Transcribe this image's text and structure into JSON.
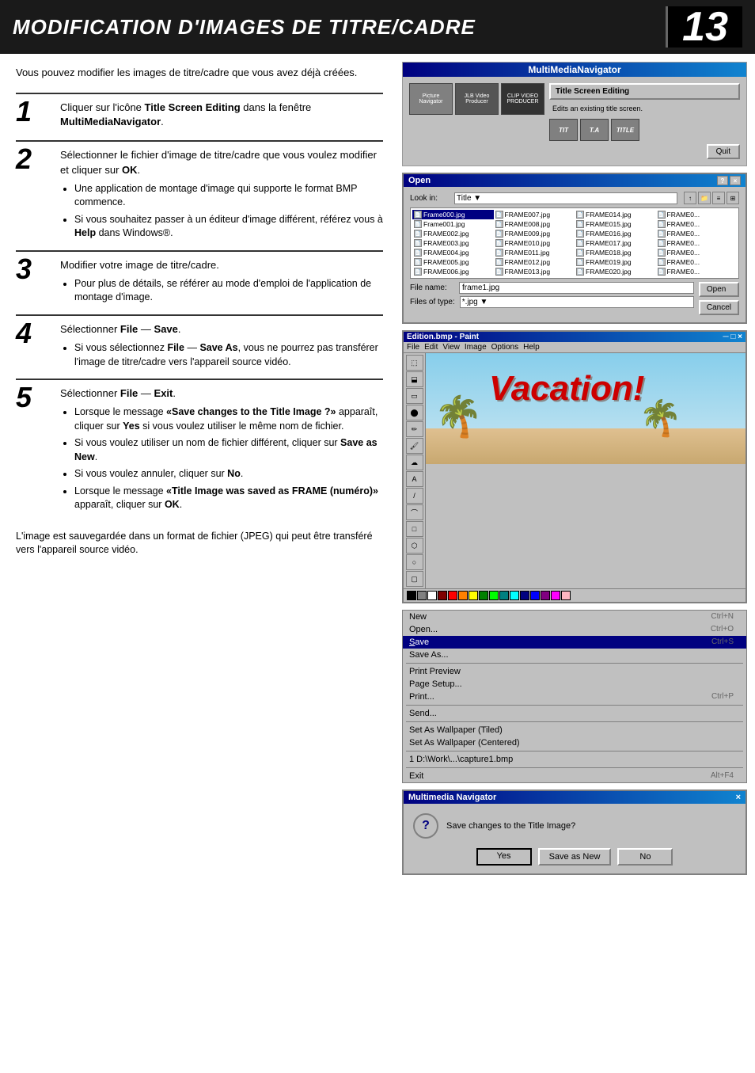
{
  "header": {
    "title": "MODIFICATION D'IMAGES DE TITRE/CADRE",
    "page_number": "13"
  },
  "subtitle": "Vous pouvez modifier les images de titre/cadre que vous avez déjà créées.",
  "steps": [
    {
      "number": "1",
      "main": "Cliquer sur l'icône <b>Title Screen Editing</b> dans la fenêtre <b>MultiMediaNavigator</b>.",
      "bullets": []
    },
    {
      "number": "2",
      "main": "Sélectionner le fichier d'image de titre/cadre que vous voulez modifier et cliquer sur <b>OK</b>.",
      "bullets": [
        "Une application de montage d'image qui supporte le format BMP commence.",
        "Si vous souhaitez passer à un éditeur d'image différent, référez vous à <b>Help</b> dans Windows®."
      ]
    },
    {
      "number": "3",
      "main": "Modifier votre image de titre/cadre.",
      "bullets": [
        "Pour plus de détails, se référer au mode d'emploi de l'application de montage d'image."
      ]
    },
    {
      "number": "4",
      "main": "Sélectionner <b>File</b> — <b>Save</b>.",
      "bullets": [
        "Si vous sélectionnez <b>File</b> — <b>Save As</b>, vous ne pourrez pas transférer l'image de titre/cadre vers l'appareil source vidéo."
      ]
    },
    {
      "number": "5",
      "main": "Sélectionner <b>File</b> — <b>Exit</b>.",
      "bullets": [
        "Lorsque le message <b>\"Save changes to the Title Image ?\"</b> apparaît, cliquer sur <b>Yes</b> si vous voulez utiliser le même nom de fichier.",
        "Si vous voulez utiliser un nom de fichier différent, cliquer sur <b>Save as New</b>.",
        "Si vous voulez annuler, cliquer sur <b>No</b>.",
        "Lorsque le message <b>\"Title Image was saved as FRAME (numéro)\"</b> apparaît, cliquer sur <b>OK</b>."
      ]
    }
  ],
  "footer_text": "L'image est sauvegardée dans un format de fichier (JPEG) qui peut être transféré vers l'appareil source vidéo.",
  "mmn_app": {
    "title": "MultiMediaNavigator",
    "picture_navigator_btn": "Picture Navigator",
    "title_screen_editing_btn": "Title Screen Editing",
    "note": "Edits an existing title screen.",
    "quit_btn": "Quit",
    "title_labels": [
      "TIT",
      "T.A",
      "TITLE"
    ]
  },
  "open_dialog": {
    "title": "Open",
    "look_in_label": "Look in:",
    "look_in_value": "Title",
    "filename_label": "File name:",
    "filename_value": "frame1.jpg",
    "filetype_label": "Files of type:",
    "filetype_value": "*.jpg",
    "open_btn": "Open",
    "cancel_btn": "Cancel",
    "files": [
      "Frame000.jpg",
      "Frame001.jpg",
      "FRAME002.jpg",
      "FRAME003.jpg",
      "FRAME004.jpg",
      "FRAME005.jpg",
      "FRAME006.jpg",
      "FRAME007.jpg",
      "FRAME008.jpg",
      "FRAME009.jpg",
      "FRAME010.jpg",
      "FRAME011.jpg",
      "FRAME012.jpg",
      "FRAME013.jpg",
      "FRAME014.jpg",
      "FRAME015.jpg",
      "FRAME016.jpg",
      "FRAME017.jpg",
      "FRAME018.jpg",
      "FRAME019.jpg",
      "FRAME020.jpg",
      "FRAME0...",
      "FRAME0...",
      "FRAME0...",
      "FRAME0...",
      "FRAME0...",
      "FRAME0...",
      "FRAME0..."
    ]
  },
  "paint_app": {
    "title": "Edition.bmp - Paint",
    "menus": [
      "File",
      "Edit",
      "View",
      "Image",
      "Options",
      "Help"
    ],
    "vacation_text": "Vacation!",
    "canvas_bg": "#87CEEB"
  },
  "file_menu": {
    "title": "File",
    "items": [
      {
        "label": "New",
        "shortcut": "Ctrl+N"
      },
      {
        "label": "Open...",
        "shortcut": "Ctrl+O"
      },
      {
        "label": "Save",
        "shortcut": "Ctrl+S",
        "underline": true
      },
      {
        "label": "Save As...",
        "shortcut": ""
      },
      {
        "label": "",
        "separator": true
      },
      {
        "label": "Print Preview",
        "shortcut": ""
      },
      {
        "label": "Page Setup...",
        "shortcut": ""
      },
      {
        "label": "Print...",
        "shortcut": "Ctrl+P"
      },
      {
        "label": "",
        "separator": true
      },
      {
        "label": "Send...",
        "shortcut": ""
      },
      {
        "label": "",
        "separator": true
      },
      {
        "label": "Set As Wallpaper (Tiled)",
        "shortcut": ""
      },
      {
        "label": "Set As Wallpaper (Centered)",
        "shortcut": ""
      },
      {
        "label": "",
        "separator": true
      },
      {
        "label": "1 D:\\Work\\...\\capture1.bmp",
        "shortcut": ""
      },
      {
        "label": "",
        "separator": true
      },
      {
        "label": "Exit",
        "shortcut": "Alt+F4"
      }
    ]
  },
  "mmn_dialog": {
    "title": "Multimedia Navigator",
    "message": "Save changes to the Title Image?",
    "yes_btn": "Yes",
    "save_as_new_btn": "Save as New",
    "no_btn": "No"
  }
}
